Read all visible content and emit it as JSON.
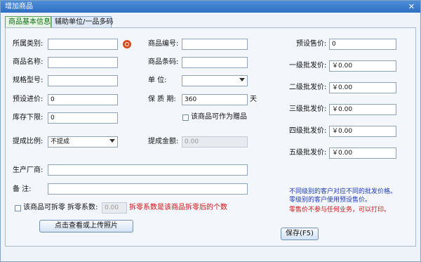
{
  "window": {
    "title": "增加商品",
    "close_glyph": "✕"
  },
  "tabs": [
    {
      "label": "商品基本信息",
      "active": true
    },
    {
      "label": "辅助单位/一品多码",
      "active": false
    }
  ],
  "left": {
    "category_label": "所属类别:",
    "category_value": "",
    "name_label": "商品名称:",
    "name_value": "",
    "spec_label": "规格型号:",
    "spec_value": "",
    "purchase_price_label": "预设进价:",
    "purchase_price_value": "0",
    "stock_min_label": "库存下限:",
    "stock_min_value": "0",
    "commission_ratio_label": "提成比例:",
    "commission_ratio_value": "不提成",
    "manufacturer_label": "生产厂商:",
    "manufacturer_value": "",
    "remark_label": "备    注:",
    "remark_value": ""
  },
  "middle": {
    "code_label": "商品编号:",
    "code_value": "",
    "barcode_label": "商品条码:",
    "barcode_value": "",
    "unit_label": "单        位:",
    "unit_value": "",
    "shelf_life_label": "保  质  期:",
    "shelf_life_value": "360",
    "shelf_life_unit": "天",
    "gift_label": "该商品可作为赠品",
    "commission_amount_label": "提成金额:",
    "commission_amount_value": "0.00"
  },
  "split": {
    "checkbox_label": "该商品可拆零",
    "ratio_label": "拆零系数:",
    "ratio_value": "0.00",
    "hint": "拆零系数是该商品拆零后的个数"
  },
  "photo_button": "点击查看或上传照片",
  "right": {
    "sale_price_label": "预设售价:",
    "sale_price_value": "0",
    "levels": [
      {
        "label": "一级批发价:",
        "value": "￥0.00"
      },
      {
        "label": "二级批发价:",
        "value": "￥0.00"
      },
      {
        "label": "三级批发价:",
        "value": "￥0.00"
      },
      {
        "label": "四级批发价:",
        "value": "￥0.00"
      },
      {
        "label": "五级批发价:",
        "value": "￥0.00"
      }
    ]
  },
  "notes": {
    "line1": "不同级别的客户对应不同的批发价格。",
    "line2": "零级别的客户使用预设售价。",
    "line3": "零售价不参与任何业务，可以打印。"
  },
  "save_button": "保存(F5)",
  "colors": {
    "accent": "#2f6fc3",
    "note_blue": "#1c39b5",
    "note_red": "#d01010"
  }
}
